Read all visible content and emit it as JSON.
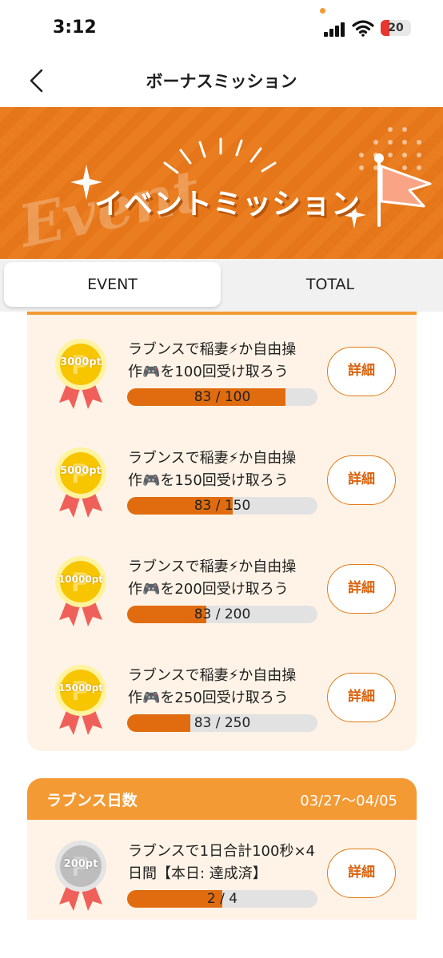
{
  "status_bar": {
    "time": "3:12",
    "battery": "20"
  },
  "nav": {
    "title": "ボーナスミッション"
  },
  "banner": {
    "title": "イベントミッション",
    "watermark": "Event"
  },
  "tabs": [
    {
      "label": "EVENT",
      "active": true
    },
    {
      "label": "TOTAL",
      "active": false
    }
  ],
  "missions": [
    {
      "reward": "3000pt",
      "line1": "ラブンスで稲妻⚡か自由操",
      "line2": "作🎮を100回受け取ろう",
      "progress_text": "83 / 100",
      "progress_fraction": 0.83,
      "button": "詳細"
    },
    {
      "reward": "5000pt",
      "line1": "ラブンスで稲妻⚡か自由操",
      "line2": "作🎮を150回受け取ろう",
      "progress_text": "83 / 150",
      "progress_fraction": 0.553,
      "button": "詳細"
    },
    {
      "reward": "10000pt",
      "line1": "ラブンスで稲妻⚡か自由操",
      "line2": "作🎮を200回受け取ろう",
      "progress_text": "83 / 200",
      "progress_fraction": 0.415,
      "button": "詳細"
    },
    {
      "reward": "15000pt",
      "line1": "ラブンスで稲妻⚡か自由操",
      "line2": "作🎮を250回受け取ろう",
      "progress_text": "83 / 250",
      "progress_fraction": 0.332,
      "button": "詳細"
    }
  ],
  "section": {
    "title": "ラブンス日数",
    "date_range": "03/27〜04/05",
    "mission": {
      "reward": "200pt",
      "line1": "ラブンスで1日合計100秒×4",
      "line2": "日間【本日: 達成済】",
      "progress_text": "2 / 4",
      "progress_fraction": 0.5,
      "button": "詳細"
    }
  },
  "colors": {
    "accent": "#f39a34",
    "banner": "#e97d1f",
    "progress": "#e06c0f",
    "card_bg": "#fef3e6",
    "gold": "#f7c600",
    "silver": "#bdbdbd",
    "ribbon": "#f0605a"
  }
}
